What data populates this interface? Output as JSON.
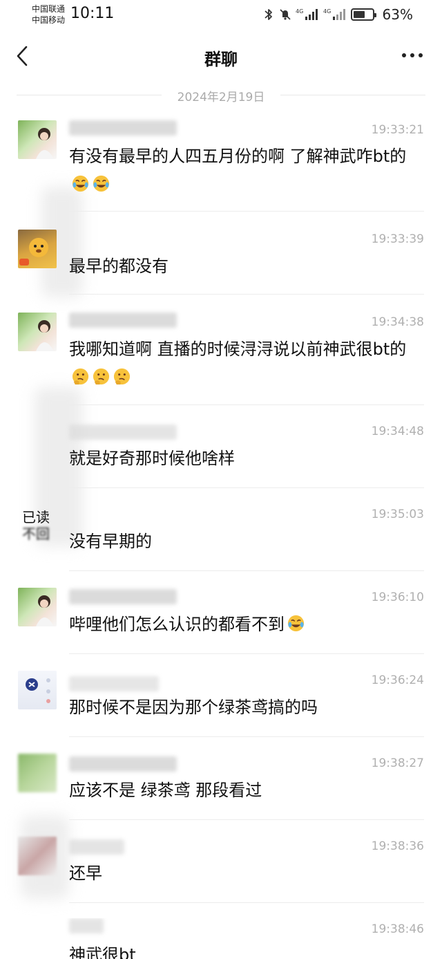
{
  "status_bar": {
    "carrier1": "中国联通",
    "carrier2": "中国移动",
    "time": "10:11",
    "battery_percent": "63%",
    "battery_level": 0.63,
    "network1": "4G",
    "network2": "4G",
    "icons": [
      "bluetooth-icon",
      "mute-icon",
      "signal-icon",
      "battery-icon"
    ]
  },
  "nav": {
    "title": "群聊",
    "back_icon": "chevron-left-icon",
    "more_icon": "more-dots-icon"
  },
  "date_separator": "2024年2月19日",
  "read_status": {
    "line1": "已读",
    "line2": "不回"
  },
  "messages": [
    {
      "time": "19:33:21",
      "text": "有没有最早的人四五月份的啊 了解神武咋bt的",
      "emojis": [
        "laugh-cry-emoji",
        "laugh-cry-emoji"
      ]
    },
    {
      "time": "19:33:39",
      "text": "最早的都没有",
      "emojis": []
    },
    {
      "time": "19:34:38",
      "text": "我哪知道啊 直播的时候浔浔说以前神武很bt的",
      "emojis": [
        "thinking-emoji",
        "thinking-emoji",
        "thinking-emoji"
      ]
    },
    {
      "time": "19:34:48",
      "text": "就是好奇那时候他啥样",
      "emojis": []
    },
    {
      "time": "19:35:03",
      "text": "没有早期的",
      "emojis": []
    },
    {
      "time": "19:36:10",
      "text": "哔哩他们怎么认识的都看不到",
      "emojis": [
        "laugh-cry-emoji"
      ]
    },
    {
      "time": "19:36:24",
      "text": "那时候不是因为那个绿茶鸢搞的吗",
      "emojis": []
    },
    {
      "time": "19:38:27",
      "text": "应该不是  绿茶鸢 那段看过",
      "emojis": []
    },
    {
      "time": "19:38:36",
      "text": "还早",
      "emojis": []
    },
    {
      "time": "19:38:46",
      "text": "神武很bt",
      "emojis": []
    }
  ],
  "colors": {
    "background": "#ffffff",
    "timestamp": "#b0b0b0",
    "divider": "#ececec",
    "emoji_yellow": "#f7c23b"
  }
}
